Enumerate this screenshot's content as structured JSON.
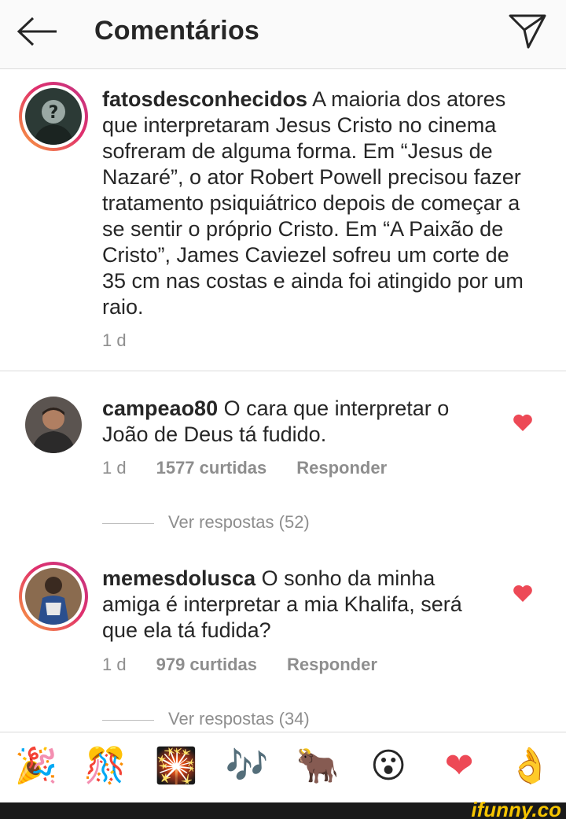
{
  "header": {
    "title": "Comentários",
    "back_icon": "arrow-left-icon",
    "share_icon": "paper-plane-icon"
  },
  "caption": {
    "username": "fatosdesconhecidos",
    "text": " A maioria dos atores que interpretaram Jesus Cristo no cinema sofreram de alguma forma. Em “Jesus de Nazaré”, o ator Robert Powell precisou fazer tratamento psiquiátrico depois de começar a se sentir o próprio Cristo. Em “A Paixão de Cristo”, James Caviezel sofreu um corte de 35 cm nas costas e ainda foi atingido por um raio.",
    "time": "1 d"
  },
  "comments": [
    {
      "username": "campeao80",
      "text": " O cara que interpretar o João de Deus tá fudido.",
      "time": "1 d",
      "likes": "1577 curtidas",
      "reply": "Responder",
      "view_replies": "Ver respostas (52)"
    },
    {
      "username": "memesdolusca",
      "text": " O sonho da minha amiga é interpretar a mia Khalifa, será que ela tá fudida?",
      "time": "1 d",
      "likes": "979 curtidas",
      "reply": "Responder",
      "view_replies": "Ver respostas (34)"
    }
  ],
  "emojis": [
    "🎉",
    "🎊",
    "🎇",
    "🎶",
    "🐂",
    "😮",
    "❤",
    "👌"
  ],
  "watermark": "ifunny.co",
  "colors": {
    "heart": "#ed4956",
    "muted": "#8e8e8e",
    "text": "#262626"
  }
}
